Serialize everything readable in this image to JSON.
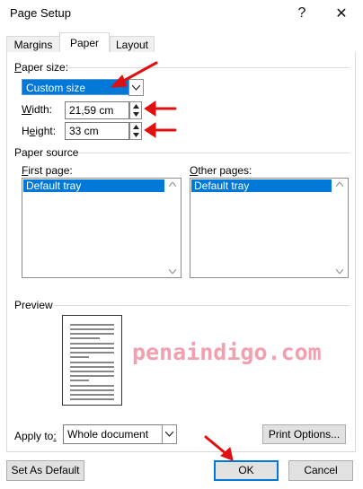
{
  "window": {
    "title": "Page Setup",
    "help": "?",
    "close": "✕"
  },
  "tabs": [
    {
      "label": "Margins"
    },
    {
      "label": "Paper"
    },
    {
      "label": "Layout"
    }
  ],
  "paper_size": {
    "group_label": "Paper size:",
    "selected": "Custom size",
    "width_label": "Width:",
    "width_value": "21,59 cm",
    "height_label": "Height:",
    "height_value": "33 cm"
  },
  "paper_source": {
    "group_label": "Paper source",
    "first_page_label": "First page:",
    "first_page_selected": "Default tray",
    "other_pages_label": "Other pages:",
    "other_pages_selected": "Default tray"
  },
  "preview": {
    "label": "Preview"
  },
  "watermark": "penaindigo.com",
  "apply": {
    "label": "Apply to:",
    "value": "Whole document"
  },
  "buttons": {
    "print_options": "Print Options...",
    "set_default": "Set As Default",
    "ok": "OK",
    "cancel": "Cancel"
  },
  "colors": {
    "selection": "#0078d7",
    "annotation_arrow": "#e01010",
    "watermark": "#f2a0b0"
  }
}
